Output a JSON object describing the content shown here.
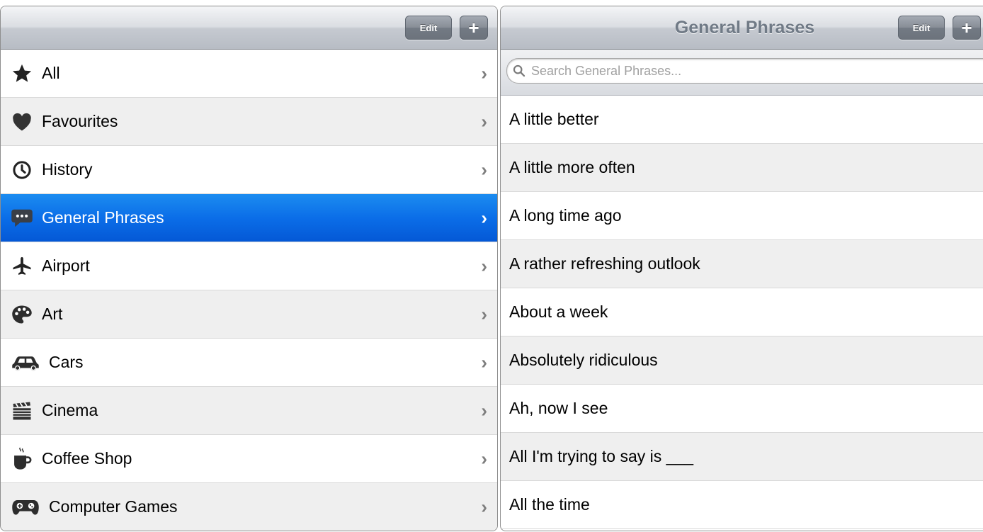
{
  "left": {
    "edit_label": "Edit",
    "add_label": "+",
    "categories": [
      {
        "label": "All",
        "icon": "star-icon"
      },
      {
        "label": "Favourites",
        "icon": "heart-icon"
      },
      {
        "label": "History",
        "icon": "clock-icon"
      },
      {
        "label": "General Phrases",
        "icon": "speech-bubble-icon",
        "selected": true
      },
      {
        "label": "Airport",
        "icon": "airplane-icon"
      },
      {
        "label": "Art",
        "icon": "palette-icon"
      },
      {
        "label": "Cars",
        "icon": "car-icon"
      },
      {
        "label": "Cinema",
        "icon": "clapperboard-icon"
      },
      {
        "label": "Coffee Shop",
        "icon": "coffee-cup-icon"
      },
      {
        "label": "Computer Games",
        "icon": "gamepad-icon"
      }
    ]
  },
  "right": {
    "title": "General Phrases",
    "edit_label": "Edit",
    "add_label": "+",
    "search_placeholder": "Search General Phrases...",
    "phrases": [
      "A little better",
      "A little more often",
      "A long time ago",
      "A rather refreshing outlook",
      "About a week",
      "Absolutely ridiculous",
      "Ah, now I see",
      "All I'm trying to say is ___",
      "All the time"
    ]
  },
  "colors": {
    "selection": "#0b6ee8",
    "row_alt": "#efefef",
    "title_text": "#707a86"
  }
}
